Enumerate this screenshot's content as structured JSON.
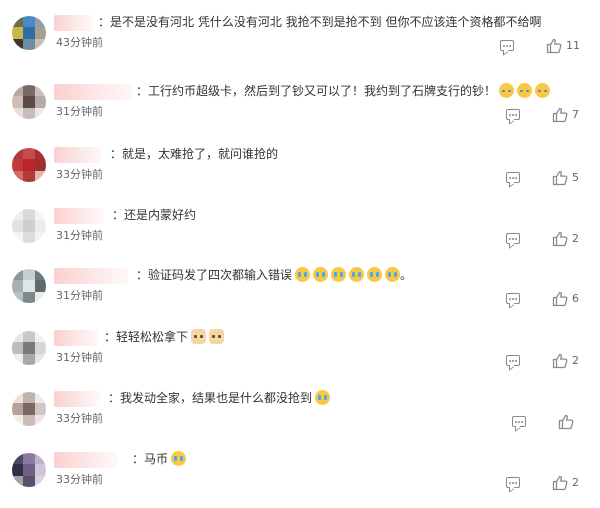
{
  "comments": [
    {
      "text": "：是不是没有河北 凭什么没有河北 我抢不到是抢不到 但你不应该连个资格都不给啊",
      "emojis": [],
      "time": "43分钟前",
      "likes": "11",
      "colors": [
        "#6e6c4a",
        "#4b88c8",
        "#8fa0a8",
        "#c6b84a",
        "#2f6ea3",
        "#a4a190",
        "#3d3b2e",
        "#6f8da0",
        "#c4c0b3"
      ]
    },
    {
      "text": "：工行约币超级卡，然后到了钞又可以了！我约到了石牌支行的钞！",
      "emojis": [
        "sweat",
        "sweat",
        "sweat"
      ],
      "time": "31分钟前",
      "likes": "7",
      "colors": [
        "#b9a8a4",
        "#7a6a66",
        "#cdbfbc",
        "#d2bdb5",
        "#5a4a48",
        "#b8aaa7",
        "#e5e0de",
        "#c9bcb8",
        "#ece7e5"
      ]
    },
    {
      "text": "：就是，太难抢了，就问谁抢的",
      "emojis": [],
      "time": "33分钟前",
      "likes": "5",
      "colors": [
        "#b03a3a",
        "#c94a4a",
        "#a9302f",
        "#c23a38",
        "#b8262a",
        "#9e2f2f",
        "#d46a66",
        "#b23b38",
        "#e7b2ae"
      ]
    },
    {
      "text": "：还是内蒙好约",
      "emojis": [],
      "time": "31分钟前",
      "likes": "2",
      "colors": [
        "#f0f0f0",
        "#d9d9d9",
        "#f4f4f4",
        "#e2e2e2",
        "#cfcfcf",
        "#ececec",
        "#f5f5f5",
        "#dcdcdc",
        "#f2f2f2"
      ]
    },
    {
      "text": "：验证码发了四次都输入错误",
      "emojis": [
        "cry",
        "cry",
        "cry",
        "cry",
        "cry",
        "cry"
      ],
      "time": "31分钟前",
      "likes": "6",
      "colors": [
        "#8e9799",
        "#c8cfd0",
        "#6f7a7c",
        "#a6b1b2",
        "#dfe4e4",
        "#5f6a6b",
        "#b9c2c3",
        "#7d888a",
        "#e9eded"
      ]
    },
    {
      "text": "：轻轻松松拿下",
      "emojis": [
        "cat",
        "cat"
      ],
      "time": "31分钟前",
      "likes": "2",
      "colors": [
        "#e8e8e8",
        "#c9c9c9",
        "#f1f1f1",
        "#bdbdbd",
        "#7a7a7a",
        "#d6d6d6",
        "#efefef",
        "#a8a8a8",
        "#e4e4e4"
      ]
    },
    {
      "text": "：我发动全家，结果也是什么都没抢到",
      "emojis": [
        "cry"
      ],
      "time": "33分钟前",
      "likes": "",
      "colors": [
        "#e9e2e0",
        "#c2b2ad",
        "#efeae8",
        "#b9a19b",
        "#7d6660",
        "#d3c5c1",
        "#f2eeec",
        "#cdbcb7",
        "#ebe5e3"
      ]
    },
    {
      "text": "：马币",
      "emojis": [
        "cry"
      ],
      "time": "33分钟前",
      "likes": "2",
      "colors": [
        "#4a4a66",
        "#8a7aa0",
        "#bdb3c7",
        "#2f2f45",
        "#6e5e88",
        "#cfc5d8",
        "#a7a1ae",
        "#58506a",
        "#d9d4de"
      ]
    }
  ]
}
